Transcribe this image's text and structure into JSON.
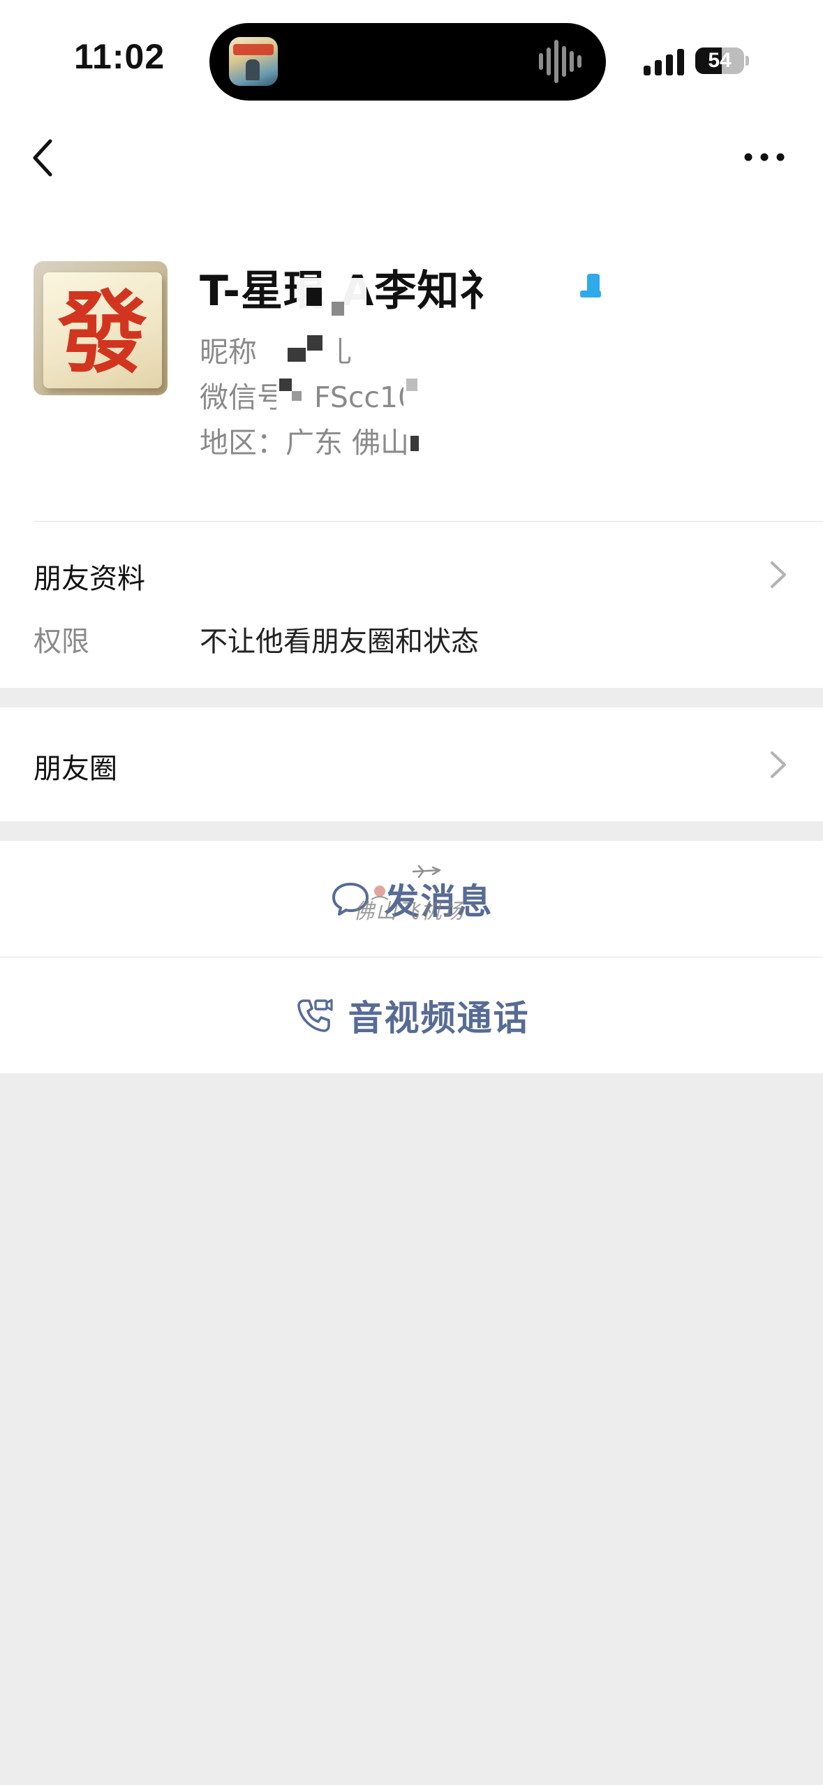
{
  "status_bar": {
    "time": "11:02",
    "battery_level": "54"
  },
  "nav": {
    "back_icon": "chevron-left-icon",
    "more_icon": "more-horizontal-icon"
  },
  "profile": {
    "avatar_glyph": "發",
    "name": "T-星琨   A李知礻",
    "nickname": "昵称：  知礼",
    "wechat_id": "微信号：FScc10",
    "region": "地区：广东 佛山"
  },
  "friend_info": {
    "title": "朋友资料",
    "permission_label": "权限",
    "permission_value": "不让他看朋友圈和状态"
  },
  "moments": {
    "label": "朋友圈"
  },
  "actions": {
    "send_message": "发消息",
    "call": "音视频通话",
    "watermark_text": "佛山飞机场"
  },
  "colors": {
    "link_blue": "#576b95",
    "background": "#ededed",
    "avatar_red": "#d2351f"
  }
}
